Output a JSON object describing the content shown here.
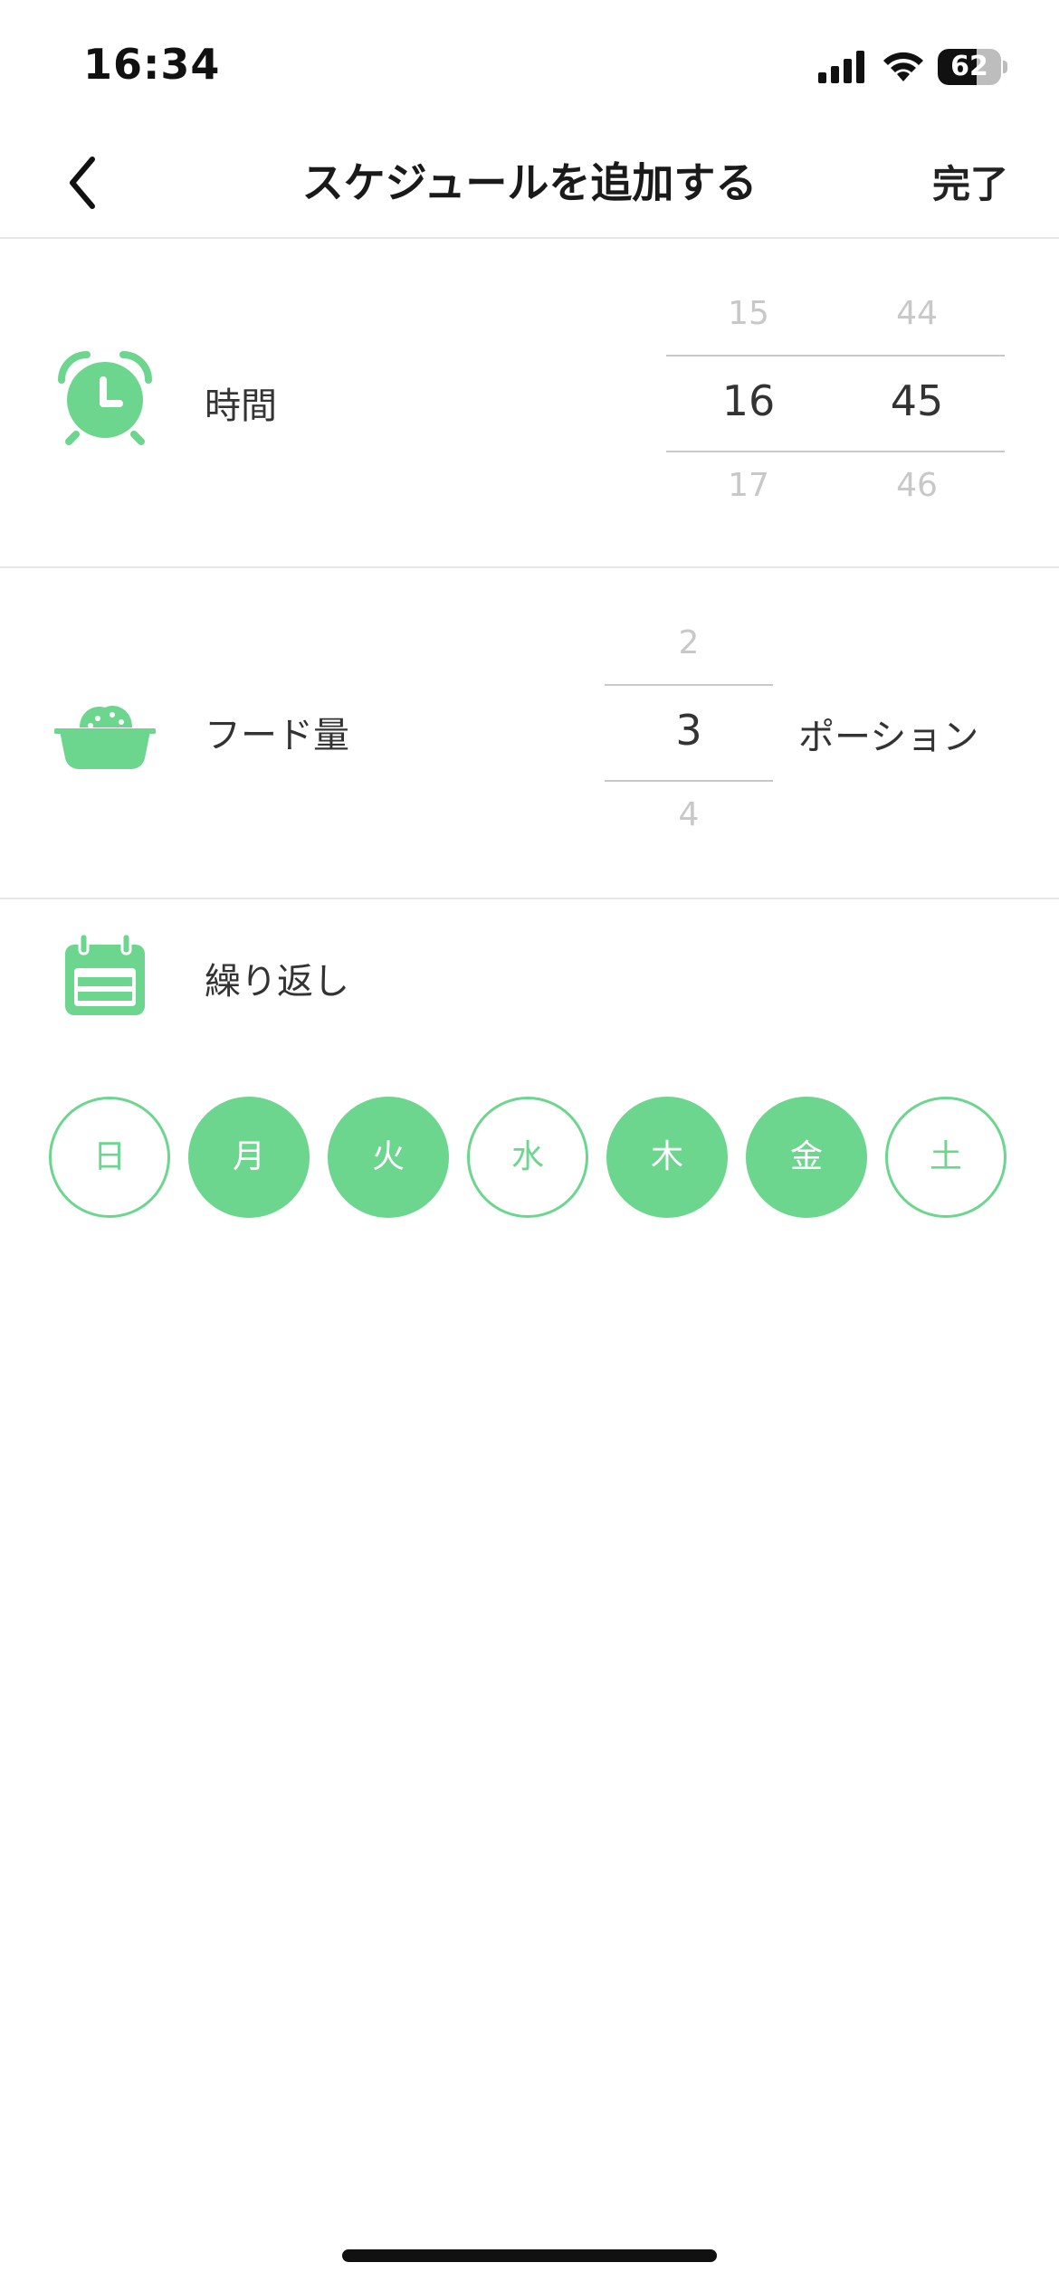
{
  "status_bar": {
    "time": "16:34",
    "battery": "62",
    "battery_level": 0.62
  },
  "nav": {
    "title": "スケジュールを追加する",
    "done_label": "完了",
    "back_icon": "chevron-left-icon"
  },
  "time_row": {
    "label": "時間",
    "icon": "alarm-clock-icon",
    "hours": {
      "prev": "15",
      "selected": "16",
      "next": "17"
    },
    "minutes": {
      "prev": "44",
      "selected": "45",
      "next": "46"
    }
  },
  "food_row": {
    "label": "フード量",
    "icon": "food-bowl-icon",
    "portions": {
      "prev": "2",
      "selected": "3",
      "next": "4"
    },
    "unit": "ポーション"
  },
  "repeat_row": {
    "label": "繰り返し",
    "icon": "calendar-icon",
    "days": [
      {
        "label": "日",
        "selected": false
      },
      {
        "label": "月",
        "selected": true
      },
      {
        "label": "火",
        "selected": true
      },
      {
        "label": "水",
        "selected": false
      },
      {
        "label": "木",
        "selected": true
      },
      {
        "label": "金",
        "selected": true
      },
      {
        "label": "土",
        "selected": false
      }
    ]
  },
  "colors": {
    "accent": "#6dd68e",
    "text": "#333333",
    "divider": "#e6e6e6"
  }
}
